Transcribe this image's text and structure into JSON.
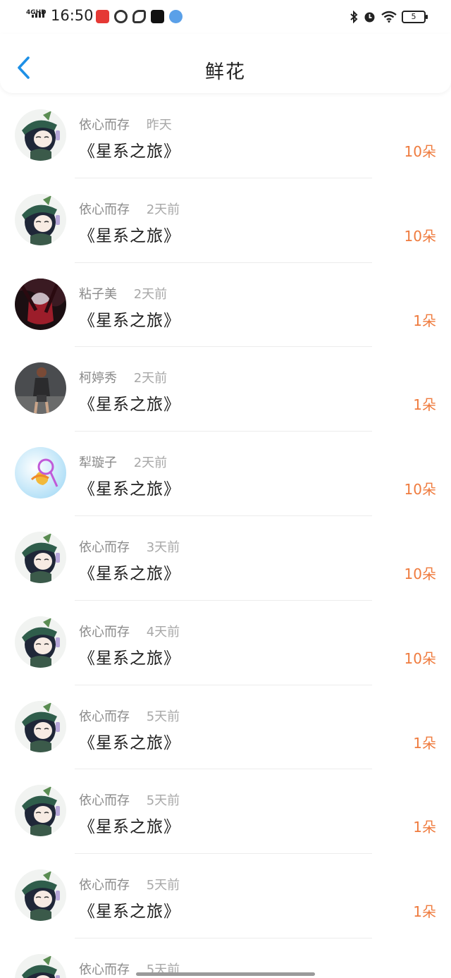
{
  "status_bar": {
    "network": "4GHD",
    "time": "16:50",
    "battery": "5"
  },
  "header": {
    "title": "鲜花"
  },
  "colors": {
    "accent": "#1e90e6",
    "amount": "#ef7b3e"
  },
  "records": [
    {
      "name": "依心而存",
      "time": "昨天",
      "book": "《星系之旅》",
      "amount": "10朵",
      "avatar": "green-hat-anime-avatar"
    },
    {
      "name": "依心而存",
      "time": "2天前",
      "book": "《星系之旅》",
      "amount": "10朵",
      "avatar": "green-hat-anime-avatar"
    },
    {
      "name": "粘子美",
      "time": "2天前",
      "book": "《星系之旅》",
      "amount": "1朵",
      "avatar": "dark-red-artwork-avatar"
    },
    {
      "name": "柯婷秀",
      "time": "2天前",
      "book": "《星系之旅》",
      "amount": "1朵",
      "avatar": "photo-portrait-avatar"
    },
    {
      "name": "犁璇子",
      "time": "2天前",
      "book": "《星系之旅》",
      "amount": "10朵",
      "avatar": "bubble-flower-avatar"
    },
    {
      "name": "依心而存",
      "time": "3天前",
      "book": "《星系之旅》",
      "amount": "10朵",
      "avatar": "green-hat-anime-avatar"
    },
    {
      "name": "依心而存",
      "time": "4天前",
      "book": "《星系之旅》",
      "amount": "10朵",
      "avatar": "green-hat-anime-avatar"
    },
    {
      "name": "依心而存",
      "time": "5天前",
      "book": "《星系之旅》",
      "amount": "1朵",
      "avatar": "green-hat-anime-avatar"
    },
    {
      "name": "依心而存",
      "time": "5天前",
      "book": "《星系之旅》",
      "amount": "1朵",
      "avatar": "green-hat-anime-avatar"
    },
    {
      "name": "依心而存",
      "time": "5天前",
      "book": "《星系之旅》",
      "amount": "1朵",
      "avatar": "green-hat-anime-avatar"
    },
    {
      "name": "依心而存",
      "time": "5天前",
      "book": "",
      "amount": "",
      "avatar": "green-hat-anime-avatar"
    }
  ]
}
